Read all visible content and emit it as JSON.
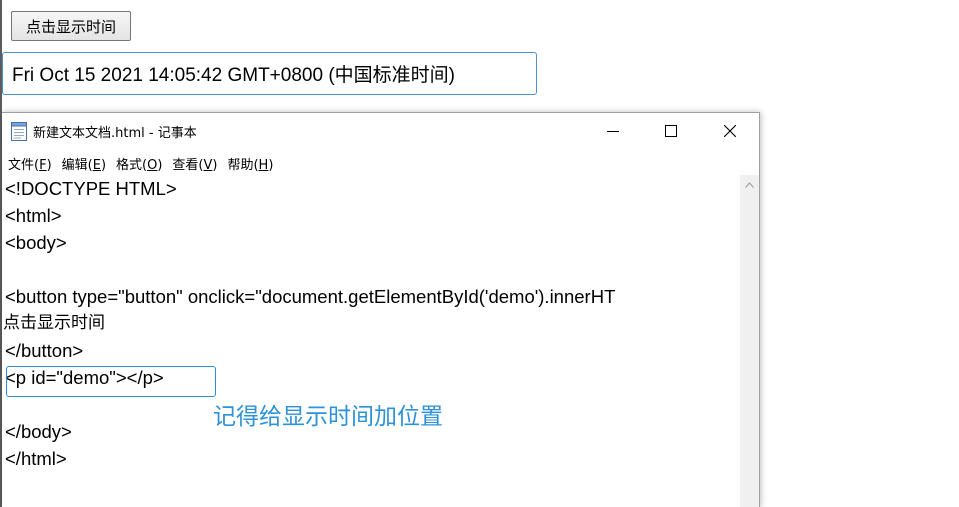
{
  "page": {
    "button_label": "点击显示时间",
    "time_text": "Fri Oct 15 2021 14:05:42 GMT+0800 (中国标准时间)"
  },
  "notepad": {
    "title": "新建文本文档.html - 记事本",
    "menu": [
      {
        "label": "文件(",
        "key": "F",
        "end": ")"
      },
      {
        "label": "编辑(",
        "key": "E",
        "end": ")"
      },
      {
        "label": "格式(",
        "key": "O",
        "end": ")"
      },
      {
        "label": "查看(",
        "key": "V",
        "end": ")"
      },
      {
        "label": "帮助(",
        "key": "H",
        "end": ")"
      }
    ],
    "lines": [
      "<!DOCTYPE HTML>",
      "<html>",
      "<body>",
      "",
      "<button type=\"button\" onclick=\"document.getElementById('demo').innerHT",
      "点击显示时间",
      "</button>",
      "<p id=\"demo\"></p>",
      "",
      "</body>",
      "</html>"
    ],
    "annotation": "记得给显示时间加位置"
  },
  "colors": {
    "accent": "#2d93d8",
    "input_border": "#4a90d9"
  },
  "icons": {
    "app": "notepad-icon",
    "minimize": "minimize-icon",
    "maximize": "maximize-icon",
    "close": "close-icon",
    "scroll_up": "scroll-up-arrow-icon"
  }
}
